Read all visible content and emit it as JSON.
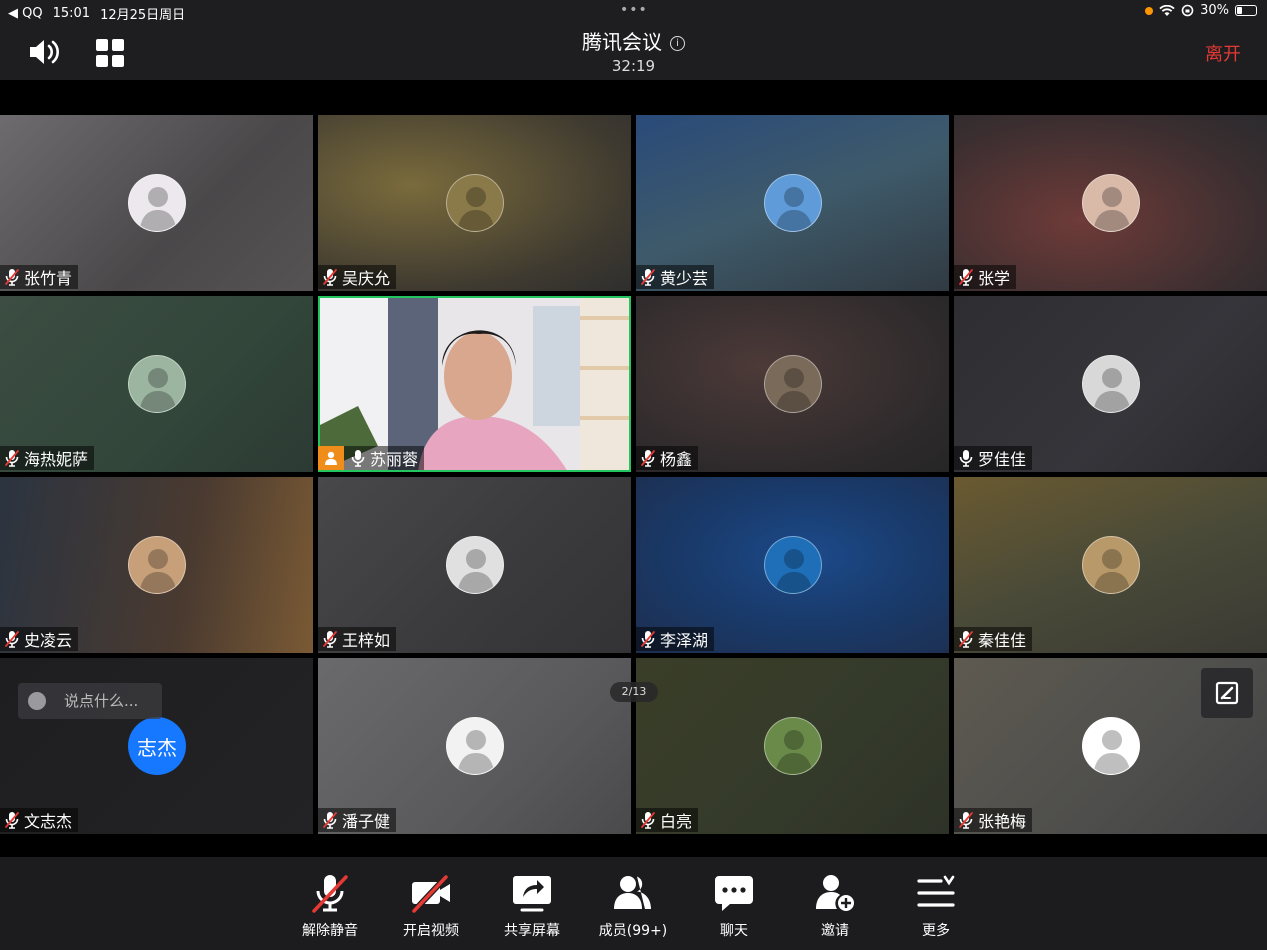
{
  "status_bar": {
    "back_app": "QQ",
    "time": "15:01",
    "date": "12月25日周日",
    "battery": "30%",
    "battery_level": 0.3
  },
  "header": {
    "title": "腾讯会议",
    "timer": "32:19",
    "leave_label": "离开"
  },
  "participants": [
    {
      "name": "张竹青",
      "mic": "muted",
      "avatar_color": "#ece8ee",
      "bg": "linear-gradient(135deg,#6d6b6e,#4a4849 60%,#565355)"
    },
    {
      "name": "吴庆允",
      "mic": "muted",
      "avatar_color": "#8a7a4a",
      "bg": "radial-gradient(ellipse at 30% 40%,#7a6b3c,#3f3a30 70%,#2e2e2e)"
    },
    {
      "name": "黄少芸",
      "mic": "muted",
      "avatar_color": "#5e9bd8",
      "bg": "linear-gradient(160deg,#2a4a7a,#3e5a6a 50%,#313a42)"
    },
    {
      "name": "张学",
      "mic": "muted",
      "avatar_color": "#d9b9a8",
      "bg": "radial-gradient(ellipse at 40% 60%,#6e3b38,#3a2e30 70%,#2b2b2e)"
    },
    {
      "name": "海热妮萨",
      "mic": "muted",
      "avatar_color": "#9bb5a0",
      "bg": "linear-gradient(135deg,#3c4d42,#32463a 60%,#2c3a33)"
    },
    {
      "name": "苏丽蓉",
      "mic": "on",
      "host": true,
      "active": true,
      "video": true,
      "avatar_color": "#e6a3b8",
      "bg": "linear-gradient(90deg,#e6e4e6,#c8d0d8 40%,#eeeae6)"
    },
    {
      "name": "杨鑫",
      "mic": "muted",
      "avatar_color": "#7a6a5a",
      "bg": "radial-gradient(ellipse at 40% 40%,#4c3a38,#2e2a2c 70%,#262626)"
    },
    {
      "name": "罗佳佳",
      "mic": "on",
      "avatar_color": "#d8d8d8",
      "bg": "linear-gradient(135deg,#2e2e32,#35353a 60%,#2a2a2e)"
    },
    {
      "name": "史凌云",
      "mic": "muted",
      "avatar_color": "#c7a07a",
      "bg": "linear-gradient(100deg,#2b3440,#4a3a30 60%,#7a5a34)"
    },
    {
      "name": "王梓如",
      "mic": "muted",
      "avatar_color": "#e0e0e0",
      "bg": "linear-gradient(135deg,#48484a,#3a3a3c 60%,#333335)"
    },
    {
      "name": "李泽湖",
      "mic": "muted",
      "avatar_color": "#1f6fb8",
      "bg": "radial-gradient(ellipse at 55% 45%,#1c4a8a,#193a6a 50%,#1e2e4e)"
    },
    {
      "name": "秦佳佳",
      "mic": "muted",
      "avatar_color": "#b89a6a",
      "bg": "linear-gradient(160deg,#6a5a30,#4a4a38 50%,#3a3a34)"
    },
    {
      "name": "文志杰",
      "mic": "muted",
      "avatar_text": "志杰",
      "avatar_color": "#1677ff",
      "bg": "linear-gradient(135deg,#1e1e20,#232325)"
    },
    {
      "name": "潘子健",
      "mic": "muted",
      "avatar_color": "#f2f2f2",
      "bg": "linear-gradient(135deg,#6a6a6c,#5a5a5c 60%,#4a4a4c)"
    },
    {
      "name": "白亮",
      "mic": "muted",
      "avatar_color": "#6a8a4a",
      "bg": "linear-gradient(135deg,#3a3e28,#343a2a 60%,#2e3228)"
    },
    {
      "name": "张艳梅",
      "mic": "muted",
      "avatar_color": "#ffffff",
      "bg": "linear-gradient(135deg,#5e5a50,#4e4e4c 60%,#424244)"
    }
  ],
  "chat": {
    "placeholder": "说点什么..."
  },
  "pagination": "2/13",
  "toolbar": [
    {
      "key": "unmute",
      "label": "解除静音",
      "icon": "mic-muted-icon"
    },
    {
      "key": "video",
      "label": "开启视频",
      "icon": "camera-off-icon"
    },
    {
      "key": "share",
      "label": "共享屏幕",
      "icon": "share-screen-icon"
    },
    {
      "key": "members",
      "label": "成员(99+)",
      "icon": "members-icon"
    },
    {
      "key": "chat",
      "label": "聊天",
      "icon": "chat-icon"
    },
    {
      "key": "invite",
      "label": "邀请",
      "icon": "add-user-icon"
    },
    {
      "key": "more",
      "label": "更多",
      "icon": "more-icon"
    }
  ],
  "colors": {
    "accent_green": "#22c55e",
    "leave_red": "#e53935",
    "host_orange": "#f08c19",
    "avatar_blue": "#1677ff"
  }
}
